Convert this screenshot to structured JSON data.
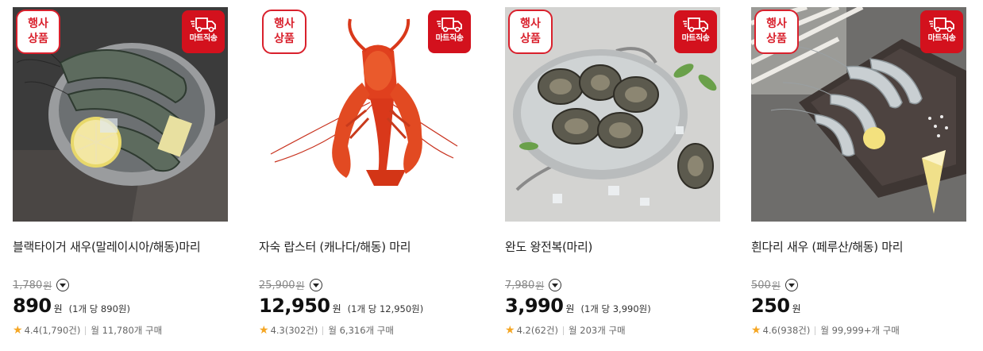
{
  "badges": {
    "event_line1": "행사",
    "event_line2": "상품",
    "mart_label": "마트직송"
  },
  "products": [
    {
      "name": "블랙타이거 새우(말레이시아/해동)마리",
      "original_price": "1,780",
      "original_unit": "원",
      "price": "890",
      "price_unit": "원",
      "unit_price": "(1개 당 890원)",
      "rating": "4.4(1,790건)",
      "purchases": "월 11,780개 구매",
      "image_icon": "shrimp-bowl-photo"
    },
    {
      "name": "자숙 랍스터 (캐나다/해동) 마리",
      "original_price": "25,900",
      "original_unit": "원",
      "price": "12,950",
      "price_unit": "원",
      "unit_price": "(1개 당 12,950원)",
      "rating": "4.3(302건)",
      "purchases": "월 6,316개 구매",
      "image_icon": "lobster-photo"
    },
    {
      "name": "완도 왕전복(마리)",
      "original_price": "7,980",
      "original_unit": "원",
      "price": "3,990",
      "price_unit": "원",
      "unit_price": "(1개 당 3,990원)",
      "rating": "4.2(62건)",
      "purchases": "월 203개 구매",
      "image_icon": "abalone-pan-photo"
    },
    {
      "name": "흰다리 새우 (페루산/해동) 마리",
      "original_price": "500",
      "original_unit": "원",
      "price": "250",
      "price_unit": "원",
      "unit_price": "",
      "rating": "4.6(938건)",
      "purchases": "월 99,999+개 구매",
      "image_icon": "shrimp-plate-photo"
    }
  ],
  "colors": {
    "accent_red": "#d3111d",
    "star": "#f5a623"
  }
}
